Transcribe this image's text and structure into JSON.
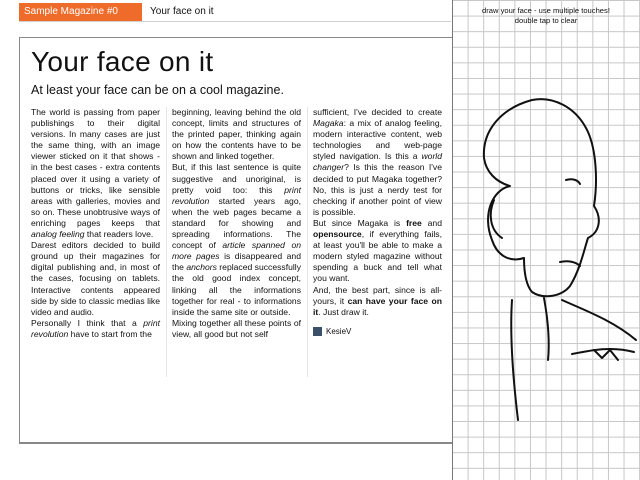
{
  "header": {
    "tab_label": "Sample Magazine #0",
    "title": "Your face on it"
  },
  "article": {
    "title": "Your face on it",
    "subtitle": "At least your face can be on a cool magazine.",
    "col1": {
      "p1_a": "The world is passing from paper publishings to their digital versions. In many cases are just the same thing, with an image viewer sticked on it that shows - in the best cases - extra contents placed over it using a variety of buttons or tricks, like sensible areas with galleries, movies and so on. These unobtrusive ways of enriching pages keeps that ",
      "p1_em": "analog feeling",
      "p1_b": " that readers love.",
      "p2": "Darest editors decided to build ground up their magazines for digital publishing and, in most of the cases, focusing on tablets. Interactive contents appeared side by side to classic medias like video and audio.",
      "p3_a": "Personally I think that a ",
      "p3_em": "print revolution",
      "p3_b": " have to start from the"
    },
    "col2": {
      "p1": "beginning, leaving behind the old concept, limits and structures of the printed paper, thinking again on how the contents have to be shown and linked together.",
      "p2_a": "But, if this last sentence is quite suggestive and unoriginal, is pretty void too: this ",
      "p2_em": "print revolution",
      "p2_b": " started years ago, when the web pages became a standard for showing and spreading informations. The concept of ",
      "p2_em2": "article spanned on more pages",
      "p2_c": " is disappeared and the ",
      "p2_em3": "anchors",
      "p2_d": " replaced successfully the old good index concept, linking all the informations together for real - to informations inside the same site or outside.",
      "p3": "Mixing together all these points of view, all good but not self"
    },
    "col3": {
      "p1_a": "sufficient, I've decided to create ",
      "p1_em": "Magaka",
      "p1_b": ": a mix of analog feeling, modern interactive content, web technologies and web-page styled navigation. Is this a ",
      "p1_em2": "world changer",
      "p1_c": "? Is this the reason I've decided to put Magaka together? No, this is just a nerdy test for checking if another point of view is possible.",
      "p2_a": "But since Magaka is ",
      "p2_b1": "free",
      "p2_b": " and ",
      "p2_b2": "opensource",
      "p2_c": ", if everything fails, at least you'll be able to make a modern styled magazine without spending a buck and tell what you want.",
      "p3_a": "And, the best part, since is all-yours, it ",
      "p3_b1": "can have your face on it",
      "p3_b": ". Just draw it.",
      "author": "KesieV"
    }
  },
  "panel": {
    "instruction_line1": "draw your face - use multiple touches!",
    "instruction_line2": "double tap to clear"
  }
}
